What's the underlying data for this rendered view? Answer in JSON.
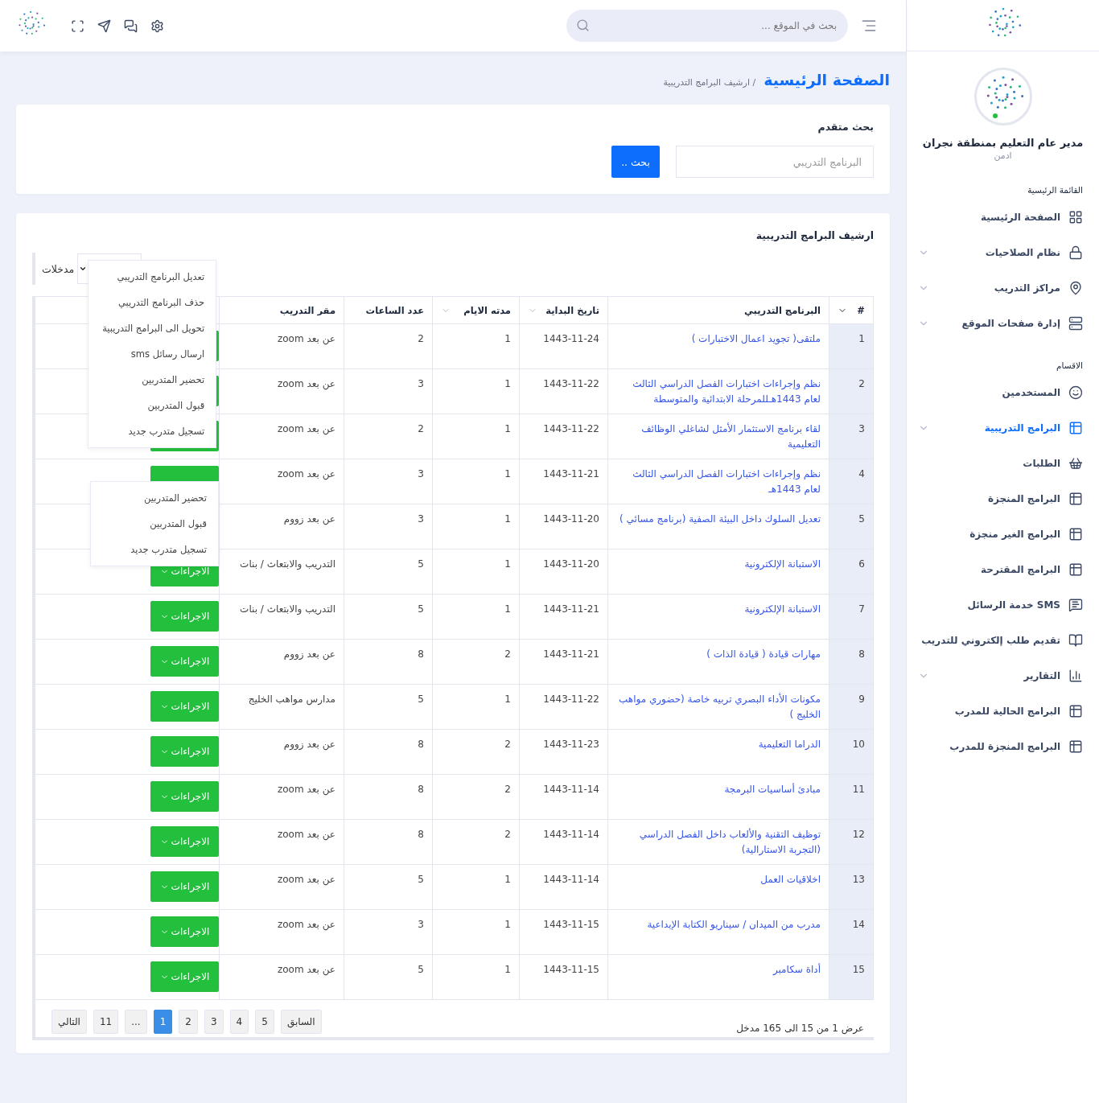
{
  "header": {
    "search": {
      "placeholder": "بحث في الموقع ..."
    }
  },
  "sidebar": {
    "profile": {
      "name": "مدير عام التعليم بمنطقة نجران",
      "role": "ادمن",
      "online": true
    },
    "sections": [
      {
        "title": "القائمة الرئيسية",
        "items": [
          {
            "label": "الصفحة الرئيسية",
            "has_submenu": false,
            "selected": false
          },
          {
            "label": "نظام الصلاحيات",
            "has_submenu": true,
            "selected": false
          },
          {
            "label": "مراكز التدريب",
            "has_submenu": true,
            "selected": false
          },
          {
            "label": "إدارة صفحات الموقع",
            "has_submenu": true,
            "selected": false
          }
        ]
      },
      {
        "title": "الاقسام",
        "items": [
          {
            "label": "المستخدمين",
            "has_submenu": false,
            "selected": false
          },
          {
            "label": "البرامج التدريبية",
            "has_submenu": true,
            "selected": true
          },
          {
            "label": "الطلبات",
            "has_submenu": false,
            "selected": false
          },
          {
            "label": "البرامج المنجزة",
            "has_submenu": false,
            "selected": false
          },
          {
            "label": "البرامج الغير منجزة",
            "has_submenu": false,
            "selected": false
          },
          {
            "label": "البرامج المقترحة",
            "has_submenu": false,
            "selected": false
          },
          {
            "label": "SMS خدمة الرسائل",
            "has_submenu": false,
            "selected": false
          },
          {
            "label": "تقديم طلب إلكتروني للتدريب",
            "has_submenu": false,
            "selected": false
          },
          {
            "label": "التقارير",
            "has_submenu": true,
            "selected": false
          },
          {
            "label": "البرامج الحالية للمدرب",
            "has_submenu": false,
            "selected": false
          },
          {
            "label": "البرامج المنجزة للمدرب",
            "has_submenu": false,
            "selected": false
          }
        ]
      }
    ]
  },
  "breadcrumb": {
    "title": "الصفحة الرئيسية",
    "current": "/ ارشيف البرامج التدريبية"
  },
  "advanced_search": {
    "title": "بحث متقدم",
    "placeholder": "البرنامج التدريبي",
    "button": "بحث .."
  },
  "archive": {
    "title": "ارشيف البرامج التدريبية",
    "entries": {
      "label": "مدخلات",
      "menu": [
        "تعديل البرنامج التدريبي",
        "حذف البرنامج التدريبي",
        "تحويل الى البرامج التدريبية",
        "ارسال رسائل sms",
        "تحضير المتدربين",
        "قبول المتدربين",
        "تسجيل متدرب جديد"
      ]
    },
    "columns": [
      {
        "label": "#",
        "sortable": true
      },
      {
        "label": "البرنامج التدريبي",
        "sortable": false
      },
      {
        "label": "تاريخ البداية",
        "sortable": true
      },
      {
        "label": "مدته الايام",
        "sortable": true
      },
      {
        "label": "عدد الساعات",
        "sortable": false
      },
      {
        "label": "مقر التدريب",
        "sortable": false
      }
    ],
    "rows": [
      {
        "n": "1",
        "program": "ملتقى( تجويد اعمال الاختبارات )",
        "start": "1443-11-24",
        "days": "1",
        "hours": "2",
        "venue": "عن بعد zoom"
      },
      {
        "n": "2",
        "program": "نظم وإجراءات اختبارات الفصل الدراسي الثالث لعام 1443هـللمرحلة الابتدائية والمتوسطة",
        "start": "1443-11-22",
        "days": "1",
        "hours": "3",
        "venue": "عن بعد zoom"
      },
      {
        "n": "3",
        "program": "لقاء برنامج الاستثمار الأمثل لشاغلي الوظائف التعليمية",
        "start": "1443-11-22",
        "days": "1",
        "hours": "2",
        "venue": "عن بعد zoom"
      },
      {
        "n": "4",
        "program": "نظم وإجراءات اختبارات الفصل الدراسي الثالث لعام 1443هـ",
        "start": "1443-11-21",
        "days": "1",
        "hours": "3",
        "venue": "عن بعد zoom",
        "menu": [
          "تحضير المتدربين",
          "قبول المتدربين",
          "تسجيل متدرب جديد"
        ]
      },
      {
        "n": "5",
        "program": "تعديل السلوك داخل البيئة الصفية (برنامج مسائي )",
        "start": "1443-11-20",
        "days": "1",
        "hours": "3",
        "venue": "عن بعد زووم",
        "button": false
      },
      {
        "n": "6",
        "program": "الاستبانة الإلكترونية",
        "start": "1443-11-20",
        "days": "1",
        "hours": "5",
        "venue": "التدريب والابتعاث / بنات",
        "action": "الاجراءات"
      },
      {
        "n": "7",
        "program": "الاستبانة الإلكترونية",
        "start": "1443-11-21",
        "days": "1",
        "hours": "5",
        "venue": "التدريب والابتعاث / بنات",
        "action": "الاجراءات"
      },
      {
        "n": "8",
        "program": "مهارات قيادة ( قيادة الذات )",
        "start": "1443-11-21",
        "days": "2",
        "hours": "8",
        "venue": "عن بعد زووم",
        "action": "الاجراءات"
      },
      {
        "n": "9",
        "program": "مكونات الأداء البصري تربيه خاصة (حضوري مواهب الخليج )",
        "start": "1443-11-22",
        "days": "1",
        "hours": "5",
        "venue": "مدارس مواهب الخليج",
        "action": "الاجراءات"
      },
      {
        "n": "10",
        "program": "الدراما التعليمية",
        "start": "1443-11-23",
        "days": "2",
        "hours": "8",
        "venue": "عن بعد زووم",
        "action": "الاجراءات"
      },
      {
        "n": "11",
        "program": "مبادئ أساسيات البرمجة",
        "start": "1443-11-14",
        "days": "2",
        "hours": "8",
        "venue": "عن بعد zoom",
        "action": "الاجراءات"
      },
      {
        "n": "12",
        "program": "توظيف التقنية والألعاب داخل الفصل الدراسي (التجربة الاستارالية)",
        "start": "1443-11-14",
        "days": "2",
        "hours": "8",
        "venue": "عن بعد zoom",
        "action": "الاجراءات"
      },
      {
        "n": "13",
        "program": "اخلاقيات العمل",
        "start": "1443-11-14",
        "days": "1",
        "hours": "5",
        "venue": "عن بعد zoom",
        "action": "الاجراءات"
      },
      {
        "n": "14",
        "program": "مدرب من الميدان / سيناريو الكتابة الإبداعية",
        "start": "1443-11-15",
        "days": "1",
        "hours": "3",
        "venue": "عن بعد zoom",
        "action": "الاجراءات"
      },
      {
        "n": "15",
        "program": "أداة سكامبر",
        "start": "1443-11-15",
        "days": "1",
        "hours": "5",
        "venue": "عن بعد zoom",
        "action": "الاجراءات"
      }
    ],
    "info": "عرض 1 من 15 الى 165 مدخل",
    "pagination": [
      {
        "label": "السابق",
        "selected": false
      },
      {
        "label": "5",
        "selected": false
      },
      {
        "label": "4",
        "selected": false
      },
      {
        "label": "3",
        "selected": false
      },
      {
        "label": "2",
        "selected": false
      },
      {
        "label": "1",
        "selected": true
      },
      {
        "label": "...",
        "selected": false
      },
      {
        "label": "11",
        "selected": false
      },
      {
        "label": "التالي",
        "selected": false
      }
    ]
  }
}
